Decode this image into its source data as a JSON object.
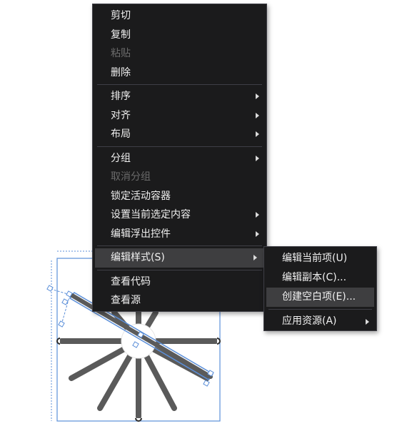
{
  "context_menu": {
    "items": [
      {
        "label": "剪切"
      },
      {
        "label": "复制"
      },
      {
        "label": "粘贴"
      },
      {
        "label": "删除"
      },
      {
        "label": "排序"
      },
      {
        "label": "对齐"
      },
      {
        "label": "布局"
      },
      {
        "label": "分组"
      },
      {
        "label": "取消分组"
      },
      {
        "label": "锁定活动容器"
      },
      {
        "label": "设置当前选定内容"
      },
      {
        "label": "编辑浮出控件"
      },
      {
        "label": "编辑样式(S)"
      },
      {
        "label": "查看代码"
      },
      {
        "label": "查看源"
      }
    ]
  },
  "submenu": {
    "items": [
      {
        "label": "编辑当前项(U)"
      },
      {
        "label": "编辑副本(C)..."
      },
      {
        "label": "创建空白项(E)..."
      },
      {
        "label": "应用资源(A)"
      }
    ]
  },
  "colors": {
    "menu_bg": "#1b1b1c",
    "menu_text": "#f1f1f1",
    "disabled_text": "#6b6b6b",
    "highlight": "#3e3e40",
    "selection_blue": "#5b8fd9",
    "spoke_gray": "#5a5a5a"
  }
}
